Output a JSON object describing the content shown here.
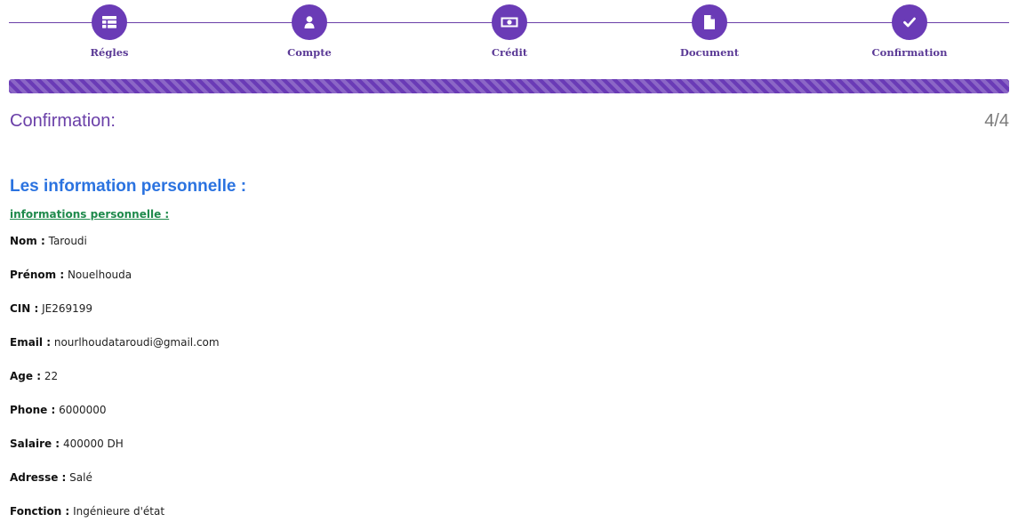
{
  "stepper": {
    "steps": [
      {
        "label": "Régles",
        "icon": "table-list-icon"
      },
      {
        "label": "Compte",
        "icon": "user-icon"
      },
      {
        "label": "Crédit",
        "icon": "money-bill-icon"
      },
      {
        "label": "Document",
        "icon": "file-icon"
      },
      {
        "label": "Confirmation",
        "icon": "check-icon"
      }
    ]
  },
  "progress": {
    "percent": 100,
    "color": "#6a3bb6"
  },
  "header": {
    "title": "Confirmation:",
    "counter": "4/4"
  },
  "section": {
    "heading": "Les information personnelle :",
    "subheading": "informations personnelle :"
  },
  "fields": [
    {
      "label": "Nom :",
      "value": "Taroudi"
    },
    {
      "label": "Prénom :",
      "value": "Nouelhouda"
    },
    {
      "label": "CIN :",
      "value": "JE269199"
    },
    {
      "label": "Email :",
      "value": "nourlhoudataroudi@gmail.com"
    },
    {
      "label": "Age :",
      "value": "22"
    },
    {
      "label": "Phone :",
      "value": "6000000"
    },
    {
      "label": "Salaire :",
      "value": "400000 DH"
    },
    {
      "label": "Adresse :",
      "value": "Salé"
    },
    {
      "label": "Fonction :",
      "value": "Ingénieure d'état"
    }
  ],
  "colors": {
    "accent": "#6a3bb6",
    "heading": "#2b73e0",
    "subheading": "#1f8a4c"
  }
}
